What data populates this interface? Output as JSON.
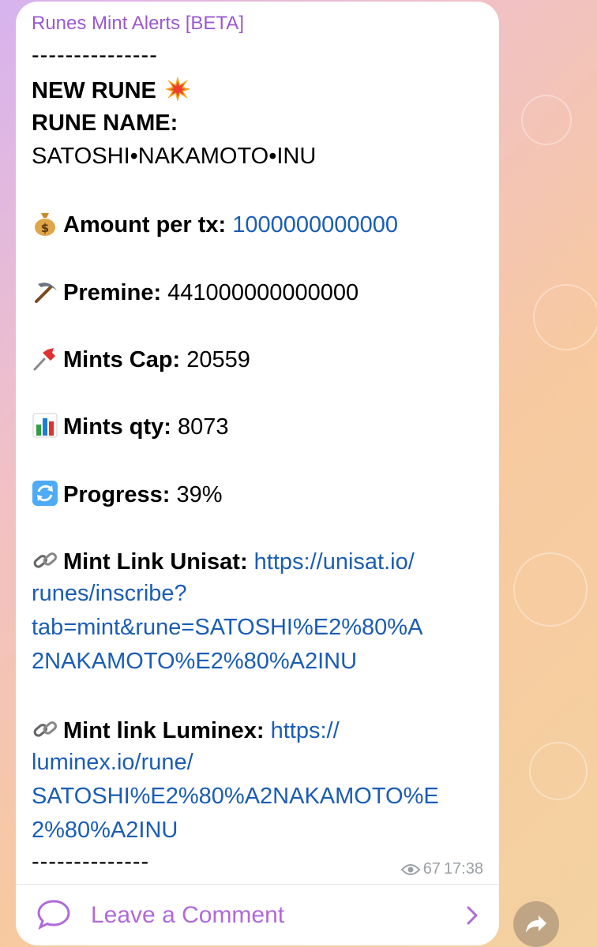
{
  "channel": {
    "name": "Runes Mint Alerts [BETA]"
  },
  "message": {
    "separator": "---------------",
    "separator_bottom": "--------------",
    "header": "NEW RUNE",
    "rune_name_label": "RUNE NAME:",
    "rune_name": "SATOSHI•NAKAMOTO•INU",
    "amount_label": "Amount per tx:",
    "amount_value": "1000000000000",
    "premine_label": "Premine:",
    "premine_value": "441000000000000",
    "cap_label": "Mints Cap:",
    "cap_value": "20559",
    "qty_label": "Mints qty:",
    "qty_value": "8073",
    "progress_label": "Progress:",
    "progress_value": "39%",
    "unisat_label": "Mint Link Unisat:",
    "unisat_link_1": "https://unisat.io/",
    "unisat_link_2": "runes/inscribe?",
    "unisat_link_3": "tab=mint&rune=SATOSHI%E2%80%A",
    "unisat_link_4": "2NAKAMOTO%E2%80%A2INU",
    "luminex_label": "Mint link Luminex:",
    "luminex_link_1": "https://",
    "luminex_link_2": "luminex.io/rune/",
    "luminex_link_3": "SATOSHI%E2%80%A2NAKAMOTO%E",
    "luminex_link_4": "2%80%A2INU"
  },
  "meta": {
    "views": "67",
    "time": "17:38"
  },
  "comment": {
    "label": "Leave a Comment"
  },
  "colors": {
    "accent": "#9b59d0",
    "link": "#1b5db5"
  },
  "icons": [
    "explosion-icon",
    "money-bag-icon",
    "pick-icon",
    "pushpin-icon",
    "bar-chart-icon",
    "refresh-icon",
    "link-icon",
    "eye-icon",
    "comment-icon",
    "chevron-right-icon",
    "share-icon"
  ]
}
